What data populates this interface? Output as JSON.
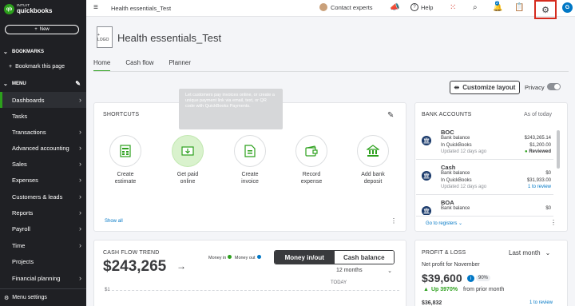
{
  "sidebar": {
    "brand_top": "INTUIT",
    "brand_name": "quickbooks",
    "new_label": "New",
    "bookmarks_header": "BOOKMARKS",
    "bookmark_action": "Bookmark this page",
    "menu_header": "MENU",
    "items": [
      {
        "label": "Dashboards"
      },
      {
        "label": "Tasks"
      },
      {
        "label": "Transactions"
      },
      {
        "label": "Advanced accounting"
      },
      {
        "label": "Sales"
      },
      {
        "label": "Expenses"
      },
      {
        "label": "Customers & leads"
      },
      {
        "label": "Reports"
      },
      {
        "label": "Payroll"
      },
      {
        "label": "Time"
      },
      {
        "label": "Projects"
      },
      {
        "label": "Financial planning"
      }
    ],
    "menu_settings": "Menu settings"
  },
  "topbar": {
    "company": "Health essentials_Test",
    "contact": "Contact experts",
    "help": "Help",
    "notification_count": "2",
    "user_initial": "G"
  },
  "header": {
    "logo_text": "+ LOGO",
    "company_name": "Health essentials_Test",
    "tabs": [
      {
        "label": "Home"
      },
      {
        "label": "Cash flow"
      },
      {
        "label": "Planner"
      }
    ],
    "customize": "Customize layout",
    "privacy": "Privacy"
  },
  "shortcuts": {
    "title": "SHORTCUTS",
    "tooltip": "Let customers pay invoices online, or create a unique payment link via email, text, or QR code with QuickBooks Payments.",
    "items": [
      {
        "line1": "Create",
        "line2": "estimate"
      },
      {
        "line1": "Get paid",
        "line2": "online"
      },
      {
        "line1": "Create",
        "line2": "invoice"
      },
      {
        "line1": "Record",
        "line2": "expense"
      },
      {
        "line1": "Add bank",
        "line2": "deposit"
      }
    ],
    "show_all": "Show all"
  },
  "bank": {
    "title": "BANK ACCOUNTS",
    "as_of": "As of today",
    "accounts": [
      {
        "name": "BOC",
        "bank_label": "Bank balance",
        "bank_value": "$243,265.14",
        "qb_label": "In QuickBooks",
        "qb_value": "$1,200.00",
        "updated": "Updated 12 days ago",
        "status": "Reviewed"
      },
      {
        "name": "Cash",
        "bank_label": "Bank balance",
        "bank_value": "$0",
        "qb_label": "In QuickBooks",
        "qb_value": "$31,933.00",
        "updated": "Updated 12 days ago",
        "status": "1 to review"
      },
      {
        "name": "BOA",
        "bank_label": "Bank balance",
        "bank_value": "$0"
      }
    ],
    "go_to_registers": "Go to registers"
  },
  "cashflow": {
    "title": "CASH FLOW TREND",
    "amount": "$243,265",
    "legend_in": "Money in",
    "legend_out": "Money out",
    "seg_on": "Money in/out",
    "seg_off": "Cash balance",
    "period": "12 months",
    "today": "TODAY",
    "axis_label": "$1",
    "color_in": "#2ca01c",
    "color_out": "#0077c5"
  },
  "pl": {
    "title": "PROFIT & LOSS",
    "period": "Last month",
    "subtitle": "Net profit for November",
    "amount": "$39,600",
    "percent": "90%",
    "change": "Up 3970%",
    "change_suffix": "from prior month",
    "partial_amount": "$36,832",
    "partial_link": "1 to review"
  }
}
